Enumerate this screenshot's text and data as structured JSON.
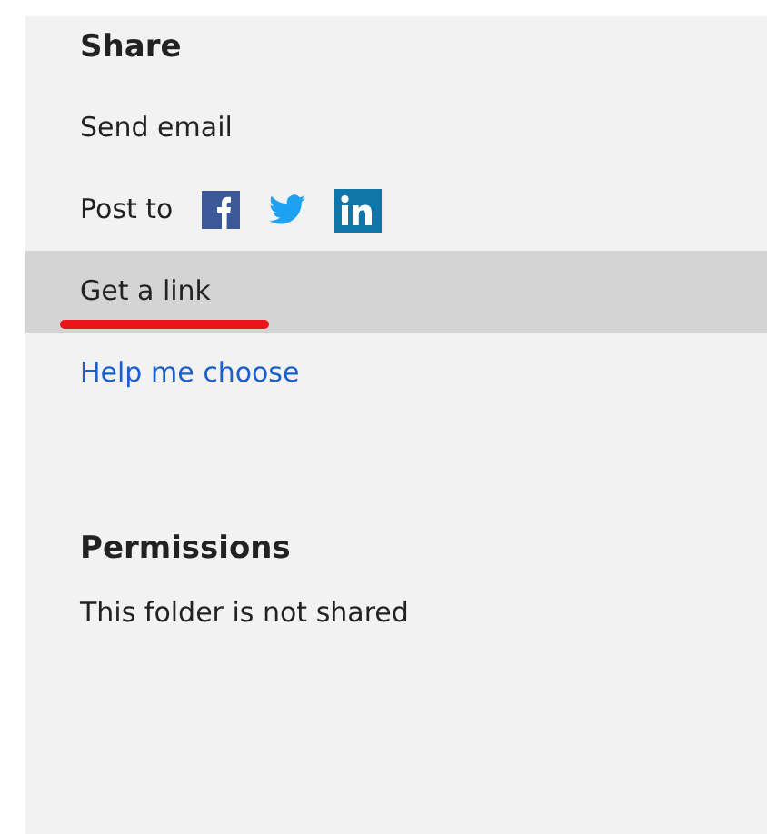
{
  "share": {
    "title": "Share",
    "items": [
      {
        "kind": "action",
        "label": "Send email",
        "selected": false,
        "underlined": false
      },
      {
        "kind": "post",
        "label": "Post to",
        "selected": false,
        "underlined": false
      },
      {
        "kind": "action",
        "label": "Get a link",
        "selected": true,
        "underlined": true
      },
      {
        "kind": "link",
        "label": "Help me choose",
        "selected": false,
        "underlined": false
      }
    ]
  },
  "permissions": {
    "title": "Permissions",
    "text": "This folder is not shared"
  }
}
